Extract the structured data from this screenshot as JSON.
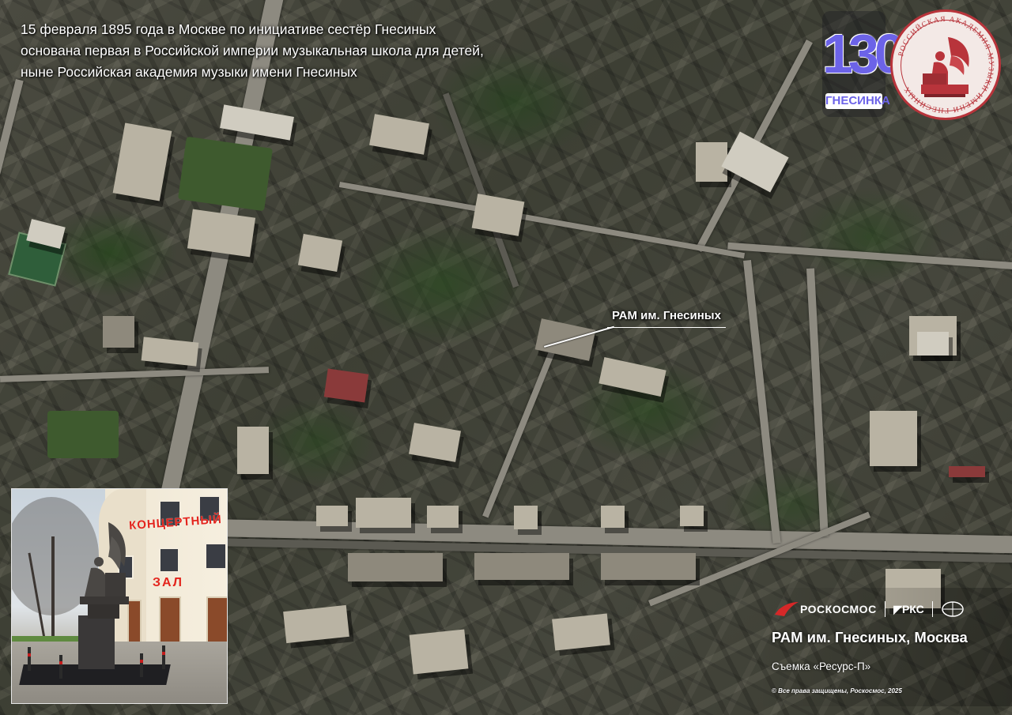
{
  "intro": {
    "lines": [
      "15 февраля 1895 года в Москве по инициативе сестёр Гнесиных",
      "основана первая в Российской империи музыкальная школа для детей,",
      "ныне Российская академия музыки имени Гнесиных"
    ]
  },
  "callout": {
    "label": "РАМ им. Гнесиных"
  },
  "logos": {
    "anniversary_number": "130",
    "anniversary_name": "ГНЕСИНКА",
    "seal_text": "РОССИЙСКАЯ АКАДЕМИЯ МУЗЫКИ ИМЕНИ ГНЕСИНЫХ",
    "accent_color": "#6c63e8",
    "seal_color": "#b8343b"
  },
  "inset_photo": {
    "sign_top": "КОНЦЕРТНЫЙ",
    "sign_bottom": "ЗАЛ"
  },
  "footer": {
    "brand_roscosmos": "РОСКОСМОС",
    "brand_rks": "РКС",
    "title": "РАМ им. Гнесиных, Москва",
    "subtitle": "Съемка «Ресурс-П»",
    "copyright": "© Все права защищены, Роскосмос, 2025",
    "brand_color": "#d62828"
  }
}
